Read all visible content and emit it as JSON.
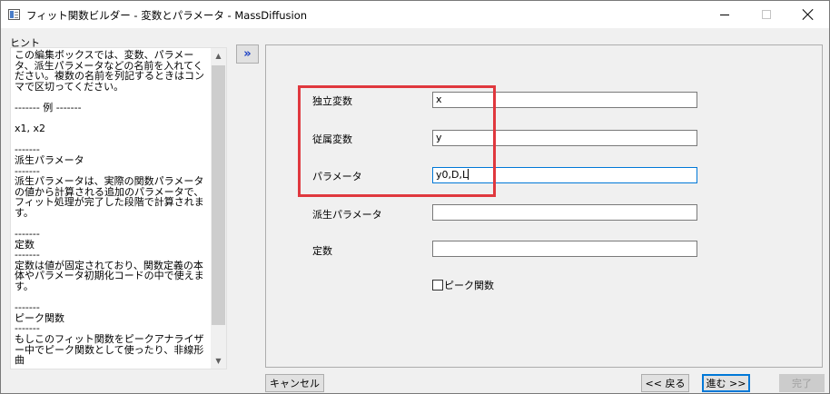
{
  "window": {
    "title": "フィット関数ビルダー - 変数とパラメータ - MassDiffusion"
  },
  "hint": {
    "title": "ヒント",
    "text": "この編集ボックスでは、変数、パラメータ、派生パラメータなどの名前を入れてください。複数の名前を列記するときはコンマで区切ってください。\n\n------- 例 -------\n\nx1, x2\n\n-------\n派生パラメータ\n-------\n派生パラメータは、実際の関数パラメータの値から計算される追加のパラメータで、フィット処理が完了した段階で計算されます。\n\n-------\n定数\n-------\n定数は値が固定されており、関数定義の本体やパラメータ初期化コードの中で使えます。\n\n-------\nピーク関数\n-------\nもしこのフィット関数をピークアナライザー中でピーク関数として使ったり、非線形曲"
  },
  "expand_button": {
    "label": "»"
  },
  "form": {
    "independent_vars": {
      "label": "独立変数",
      "value": "x"
    },
    "dependent_vars": {
      "label": "従属変数",
      "value": "y"
    },
    "parameters": {
      "label": "パラメータ",
      "value": "y0,D,L"
    },
    "derived_parameters": {
      "label": "派生パラメータ",
      "value": ""
    },
    "constants": {
      "label": "定数",
      "value": ""
    },
    "peak_function": {
      "label": "ピーク関数",
      "checked": false
    }
  },
  "buttons": {
    "cancel": "キャンセル",
    "back": "<< 戻る",
    "next": "進む >>",
    "finish": "完了"
  },
  "colors": {
    "highlight": "#e0383e",
    "focus": "#0078d7",
    "expand_arrow": "#1a3fc4"
  }
}
